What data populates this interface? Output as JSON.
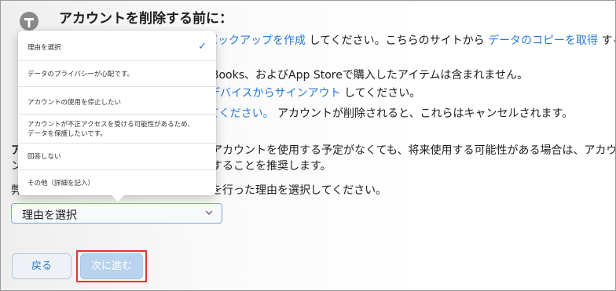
{
  "heading": "アカウントを削除する前に：",
  "content": {
    "line1": {
      "link1": "バックアップを作成",
      "text1": " してください。こちらのサイトから ",
      "link2": "データのコピーを取得",
      "text2": " する"
    },
    "line2": "iBooks、およびApp Storeで購入したアイテムは含まれません。",
    "line3": {
      "link": "デバイスからサインアウト",
      "text": " してください。"
    },
    "line4": {
      "link": "てください。",
      "text": " アカウントが削除されると、これらはキャンセルされます。"
    },
    "line5": "アカウントを使用する予定がなくても、将来使用する可能性がある場合は、アカウン",
    "line6": "することを推奨します。",
    "line7": "を行った理由を選択してください。",
    "stub_a": "ア",
    "stub_n": "ン",
    "stub_h": "弊"
  },
  "dropdown_menu": {
    "items": [
      {
        "label": "理由を選択",
        "selected": true,
        "check": "✓"
      },
      {
        "label": "データのプライバシーが心配です。"
      },
      {
        "label": "アカウントの使用を停止したい"
      },
      {
        "label_line1": "アカウントが不正アクセスを受ける可能性があるため、",
        "label_line2": "データを保護したいです。"
      },
      {
        "label": "回答しない"
      },
      {
        "label": "その他（詳細を記入）"
      }
    ]
  },
  "select": {
    "value": "理由を選択"
  },
  "buttons": {
    "back": "戻る",
    "next": "次に進む"
  },
  "colors": {
    "link": "#2a7bd4",
    "highlight_border": "#e3342f",
    "next_disabled_bg": "#b9d3ef"
  },
  "icons": {
    "user": "user-circle-icon",
    "chevron": "chevron-down-icon",
    "check": "checkmark-icon"
  }
}
